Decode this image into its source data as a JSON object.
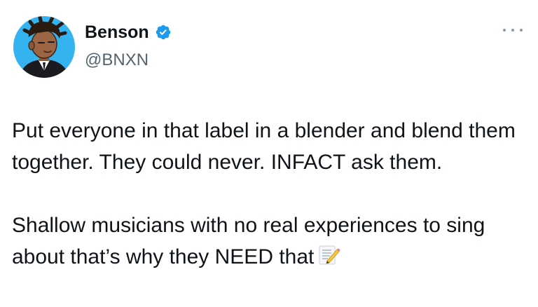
{
  "author": {
    "display_name": "Benson",
    "handle": "@BNXN",
    "verified": true,
    "avatar_background": "#35b3f0"
  },
  "icons": {
    "verified": "verified-badge-icon",
    "more": "more-options-icon",
    "memo": "memo-emoji-icon"
  },
  "tweet": {
    "paragraphs": [
      "Put everyone in that label in a blender and blend them together. They could never. INFACT ask them.",
      "Shallow musicians with no real experiences to sing about that’s why they NEED that"
    ]
  },
  "colors": {
    "text_primary": "#0f1419",
    "text_secondary": "#536471",
    "verified_blue": "#1d9bf0"
  }
}
